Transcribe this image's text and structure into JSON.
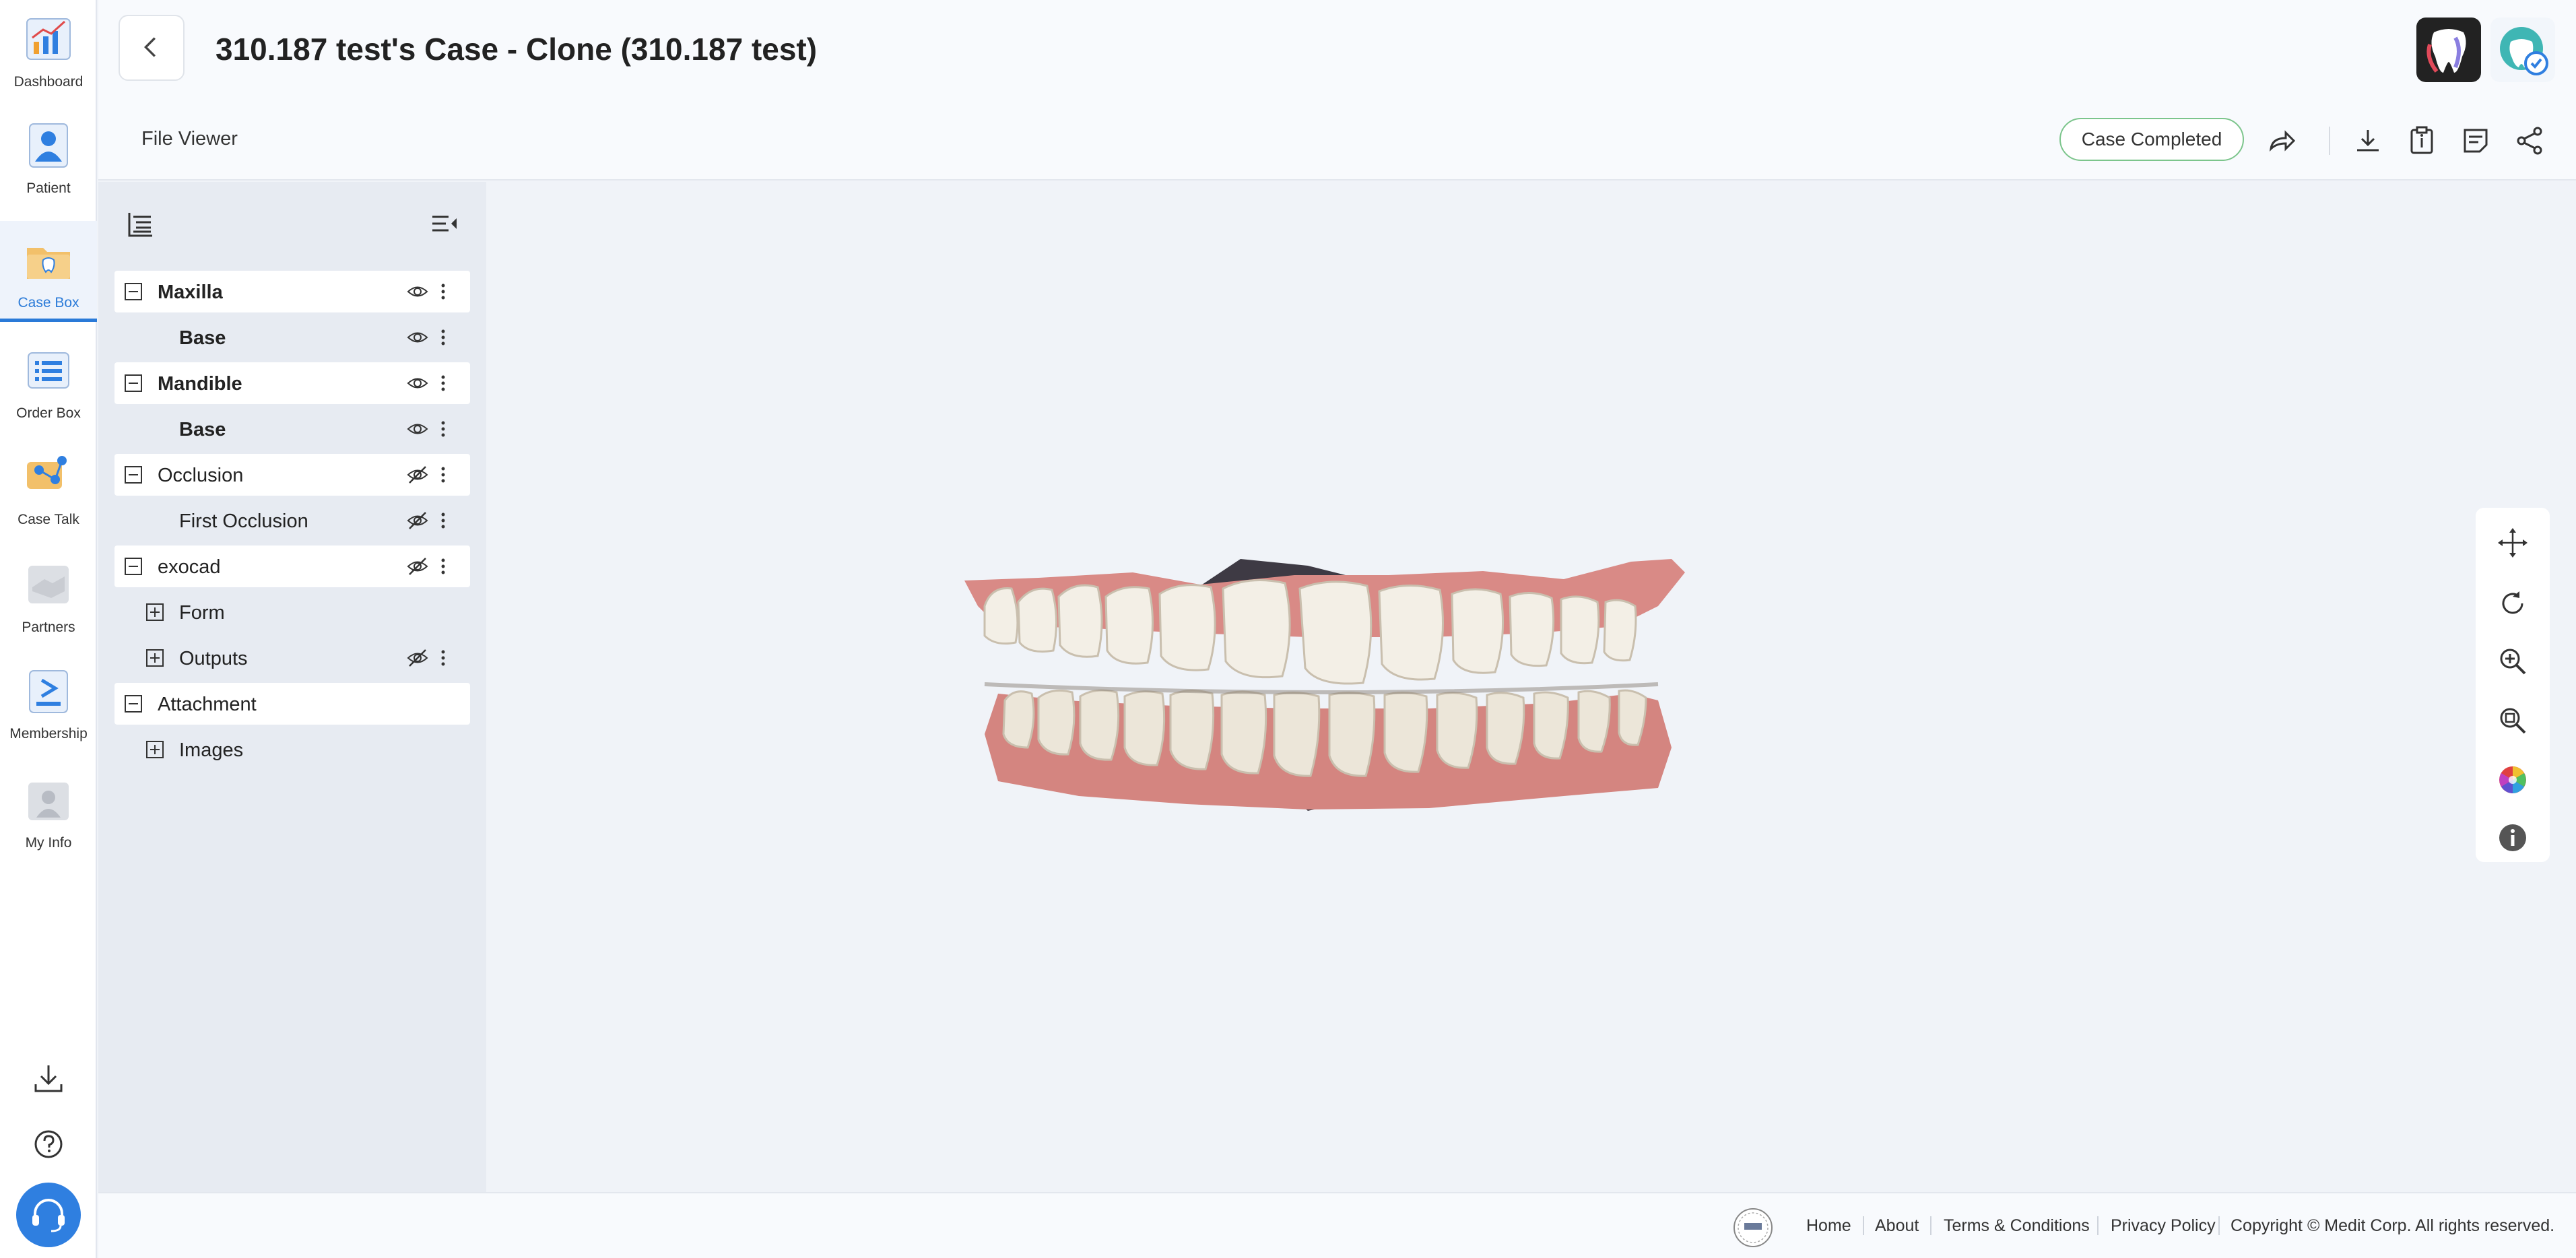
{
  "nav": {
    "items": [
      {
        "label": "Dashboard",
        "icon": "dashboard-chart-icon"
      },
      {
        "label": "Patient",
        "icon": "patient-icon"
      },
      {
        "label": "Case Box",
        "icon": "case-box-icon",
        "active": true
      },
      {
        "label": "Order Box",
        "icon": "order-box-icon"
      },
      {
        "label": "Case Talk",
        "icon": "case-talk-icon"
      },
      {
        "label": "Partners",
        "icon": "partners-icon"
      },
      {
        "label": "Membership",
        "icon": "membership-icon"
      },
      {
        "label": "My Info",
        "icon": "my-info-icon"
      }
    ]
  },
  "header": {
    "title": "310.187 test's Case - Clone (310.187 test)"
  },
  "subbar": {
    "viewer_title": "File Viewer",
    "status": "Case Completed"
  },
  "tree": {
    "rows": [
      {
        "label": "Maxilla",
        "bold": true,
        "toggle": "minus",
        "visible": true
      },
      {
        "label": "Base",
        "bold": true,
        "toggle": "none",
        "visible": true
      },
      {
        "label": "Mandible",
        "bold": true,
        "toggle": "minus",
        "visible": true
      },
      {
        "label": "Base",
        "bold": true,
        "toggle": "none",
        "visible": true
      },
      {
        "label": "Occlusion",
        "bold": false,
        "toggle": "minus",
        "visible": false
      },
      {
        "label": "First Occlusion",
        "bold": false,
        "toggle": "none",
        "visible": false
      },
      {
        "label": "exocad",
        "bold": false,
        "toggle": "minus",
        "visible": false
      },
      {
        "label": "Form",
        "bold": false,
        "toggle": "plus"
      },
      {
        "label": "Outputs",
        "bold": false,
        "toggle": "plus",
        "visible": false
      },
      {
        "label": "Attachment",
        "bold": false,
        "toggle": "minus"
      },
      {
        "label": "Images",
        "bold": false,
        "toggle": "plus"
      }
    ]
  },
  "footer": {
    "links": [
      "Home",
      "About",
      "Terms & Conditions",
      "Privacy Policy"
    ],
    "copyright": "Copyright © Medit Corp. All rights reserved."
  },
  "colors": {
    "accent": "#2a7ad8",
    "status_border": "#7cc58c",
    "gum": "#d98a86",
    "tooth": "#f3efe6"
  }
}
